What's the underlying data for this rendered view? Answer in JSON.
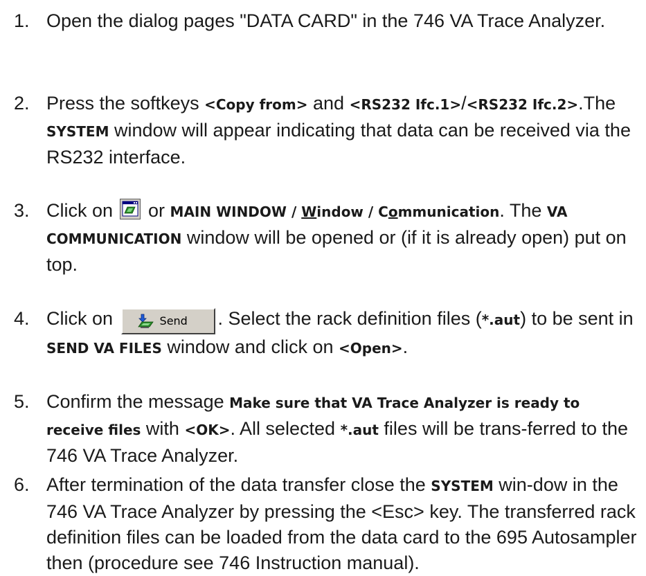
{
  "steps": [
    {
      "number": "1.",
      "text_1": "Open the dialog pages \"DATA CARD\" in the 746 VA Trace Analyzer."
    },
    {
      "number": "2.",
      "text_1": "Press the softkeys ",
      "key_copy_from": "<Copy from>",
      "text_2": " and ",
      "key_ifc1": "<RS232 Ifc.1>",
      "text_3": "/",
      "key_ifc2": "<RS232 Ifc.2>",
      "text_4": ".The ",
      "window_system": "SYSTEM",
      "text_5": " window will appear indicating that data can be received via the RS232 interface."
    },
    {
      "number": "3.",
      "text_1": "Click on ",
      "icon": "communication-window-icon",
      "text_2": " or ",
      "menu_main_window": "MAIN WINDOW / ",
      "menu_w": "W",
      "menu_indow": "indow / C",
      "menu_o": "o",
      "menu_mmunication": "mmunication",
      "text_3": ". The ",
      "window_va_comm": "VA COMMUNICATION",
      "text_4": " window will be opened or (if it is already open) put on top."
    },
    {
      "number": "4.",
      "text_1": "Click on ",
      "send_button_label": "Send",
      "text_2": ". Select the rack definition files (",
      "file_pattern": "*.aut",
      "text_3": ") to be sent in ",
      "window_send_va_files": "SEND VA FILES",
      "text_4": " window and click on ",
      "key_open": "<Open>",
      "text_5": "."
    },
    {
      "number": "5.",
      "text_1": "Confirm the message ",
      "message": "Make sure that VA Trace Analyzer is ready to receive files",
      "text_2": " with ",
      "key_ok": "<OK>",
      "text_3": ". All selected ",
      "file_pattern": "*.aut",
      "text_4": " files will be trans-ferred to the 746 VA Trace Analyzer."
    },
    {
      "number": "6.",
      "text_1": "After termination of the data transfer close the ",
      "window_system": "SYSTEM",
      "text_2": " win-dow in the 746 VA Trace Analyzer by pressing the <Esc> key. The transferred rack definition files can be loaded from the data card to the 695 Autosampler then (procedure see 746 Instruction manual)."
    }
  ]
}
